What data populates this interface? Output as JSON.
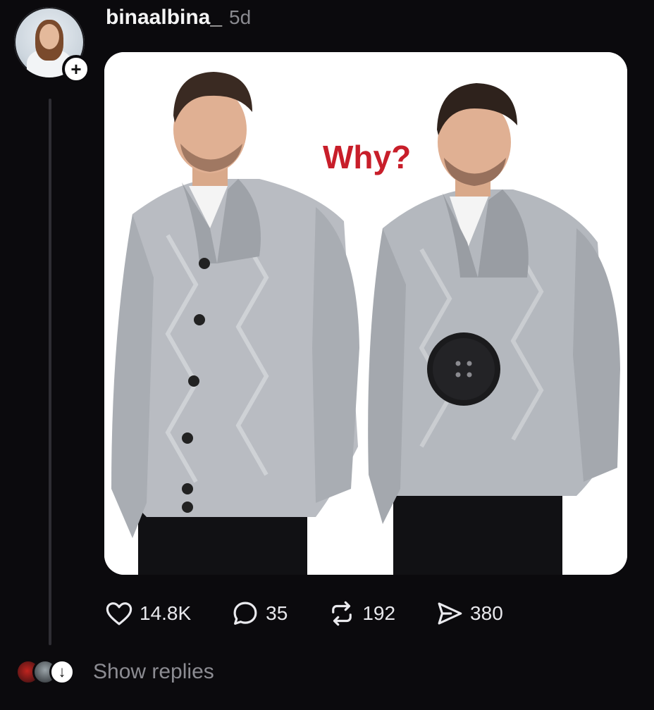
{
  "post": {
    "username": "binaalbina_",
    "time": "5d",
    "image_caption": "Why?"
  },
  "actions": {
    "likes": "14.8K",
    "replies": "35",
    "reposts": "192",
    "shares": "380"
  },
  "footer": {
    "show_replies": "Show replies"
  },
  "colors": {
    "background": "#0b0a0d",
    "caption_red": "#c81e2a",
    "muted_text": "#8a8a90"
  },
  "icons": [
    "heart-icon",
    "comment-icon",
    "repost-icon",
    "share-icon",
    "plus-icon",
    "arrow-down-icon"
  ]
}
